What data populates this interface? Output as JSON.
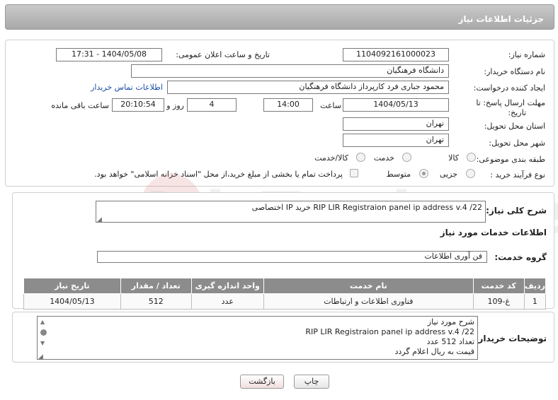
{
  "header": {
    "title": "جزئیات اطلاعات نیاز"
  },
  "form": {
    "need_number_label": "شماره نیاز:",
    "need_number": "1104092161000023",
    "announce_label": "تاریخ و ساعت اعلان عمومی:",
    "announce_value": "1404/05/08 - 17:31",
    "buyer_org_label": "نام دستگاه خریدار:",
    "buyer_org": "دانشگاه فرهنگیان",
    "requester_label": "ایجاد کننده درخواست:",
    "requester": "محمود جباری فرد کارپرداز دانشگاه فرهنگیان",
    "contact_link": "اطلاعات تماس خریدار",
    "deadline_label_1": "مهلت ارسال پاسخ: تا",
    "deadline_label_2": "تاریخ:",
    "deadline_date": "1404/05/13",
    "time_label": "ساعت",
    "deadline_time": "14:00",
    "days_value": "4",
    "days_label": "روز و",
    "remaining_time": "20:10:54",
    "remaining_label": "ساعت باقی مانده",
    "province_label": "استان محل تحویل:",
    "province": "تهران",
    "city_label": "شهر محل تحویل:",
    "city": "تهران",
    "category_label": "طبقه بندی موضوعی:",
    "category_options": [
      "کالا",
      "خدمت",
      "کالا/خدمت"
    ],
    "process_label": "نوع فرآیند خرید :",
    "process_options": [
      "جزیی",
      "متوسط"
    ],
    "payment_note": "پرداخت تمام یا بخشی از مبلغ خرید،از محل \"اسناد خزانه اسلامی\" خواهد بود."
  },
  "summary": {
    "label": "شرح کلی نیاز:",
    "value": "RIP LIR Registraion panel ip address v.4 /22  خرید  IP اختصاصی"
  },
  "services": {
    "section_title": "اطلاعات خدمات مورد نیاز",
    "group_label": "گروه خدمت:",
    "group_value": "فن آوری اطلاعات",
    "columns": [
      "ردیف",
      "کد خدمت",
      "نام خدمت",
      "واحد اندازه گیری",
      "تعداد / مقدار",
      "تاریخ نیاز"
    ],
    "rows": [
      {
        "idx": "1",
        "code": "غ-109",
        "name": "فناوری اطلاعات و ارتباطات",
        "unit": "عدد",
        "qty": "512",
        "date": "1404/05/13"
      }
    ]
  },
  "notes": {
    "label": "توضیحات خریدار:",
    "lines": [
      "شرح مورد نیاز",
      "RIP LIR Registraion panel ip address v.4 /22",
      "تعداد 512 عدد",
      "قیمت به ریال اعلام گردد"
    ]
  },
  "buttons": {
    "print": "چاپ",
    "back": "بازگشت"
  },
  "watermark": "AriaTender.neT"
}
